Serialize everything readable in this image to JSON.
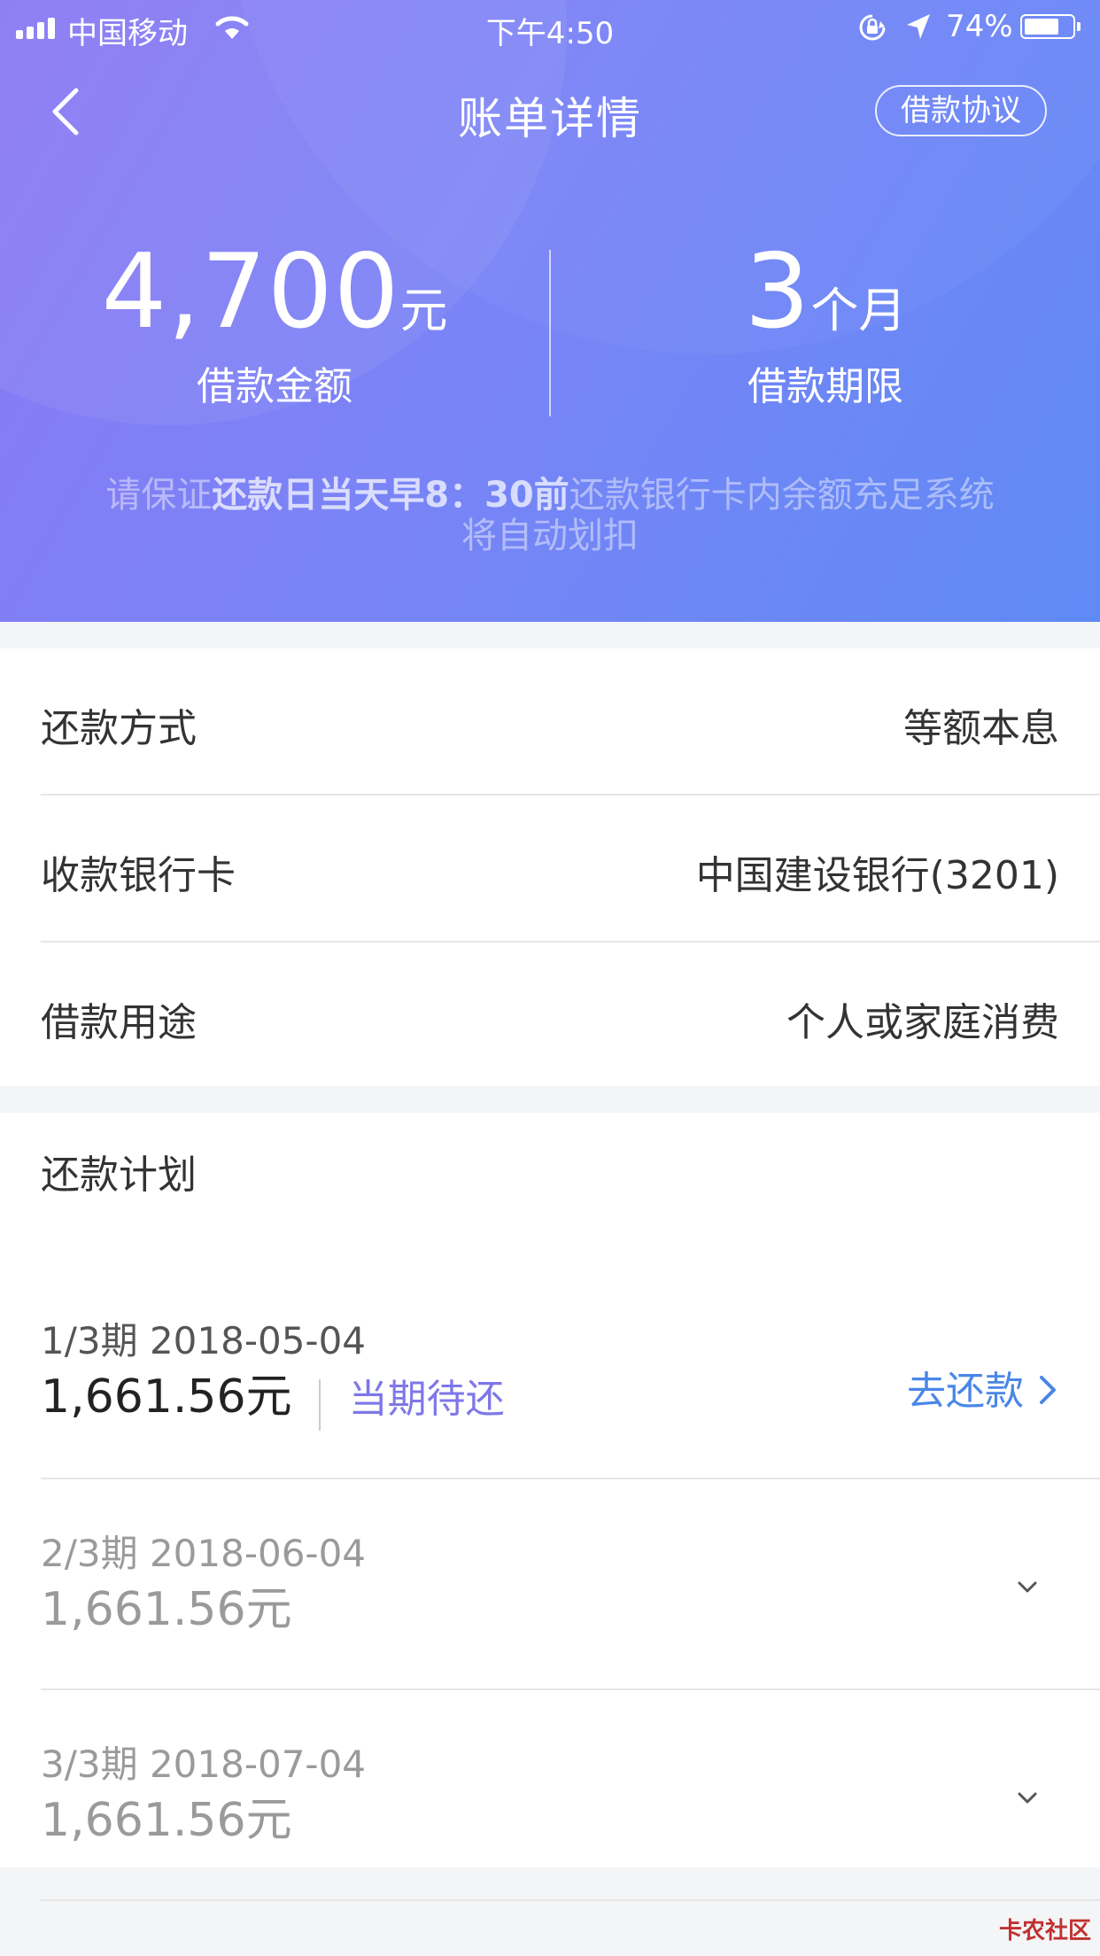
{
  "status_bar": {
    "carrier": "中国移动",
    "time": "下午4:50",
    "battery": "74%",
    "battery_level": 0.74
  },
  "nav": {
    "title": "账单详情",
    "agreement_label": "借款协议"
  },
  "summary": {
    "amount": {
      "value": "4,700",
      "unit": "元",
      "label": "借款金额"
    },
    "term": {
      "value": "3",
      "unit": "个月",
      "label": "借款期限"
    },
    "notice_prefix": "请保证",
    "notice_emphasis": "还款日当天早8：30前",
    "notice_suffix": "还款银行卡内余额充足系统将自动划扣"
  },
  "info": {
    "rows": [
      {
        "label": "还款方式",
        "value": "等额本息"
      },
      {
        "label": "收款银行卡",
        "value": "中国建设银行(3201)"
      },
      {
        "label": "借款用途",
        "value": "个人或家庭消费"
      }
    ]
  },
  "plan": {
    "title": "还款计划",
    "items": [
      {
        "period": "1/3期 2018-05-04",
        "amount": "1,661.56元",
        "status": "当期待还",
        "action": "去还款"
      },
      {
        "period": "2/3期 2018-06-04",
        "amount": "1,661.56元"
      },
      {
        "period": "3/3期 2018-07-04",
        "amount": "1,661.56元"
      }
    ]
  },
  "watermark": "卡农社区",
  "colors": {
    "header_gradient_start": "#8a78f4",
    "header_gradient_end": "#5f8af5",
    "link_blue": "#4a86e8",
    "status_purple": "#7e77e8"
  }
}
